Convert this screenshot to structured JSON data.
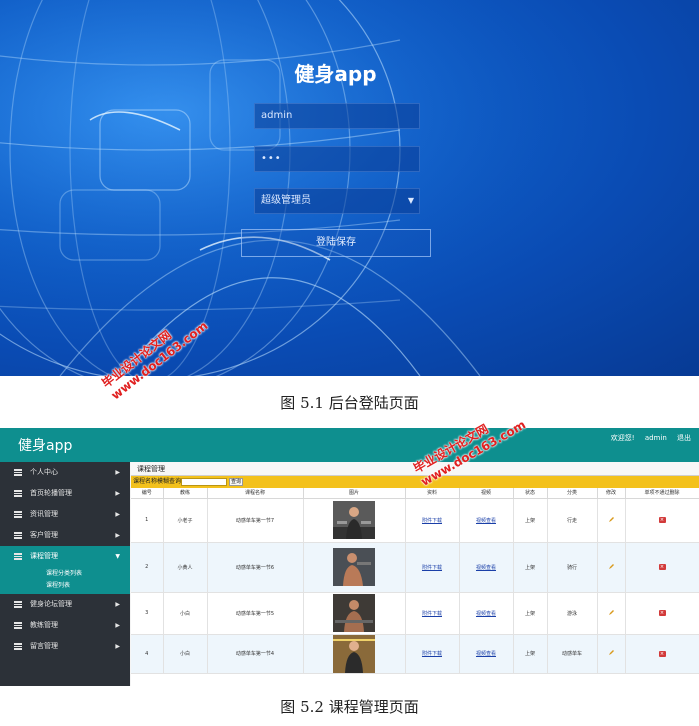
{
  "login": {
    "title": "健身app",
    "username": "admin",
    "password_mask": "•••",
    "role": "超级管理员",
    "submit": "登陆保存"
  },
  "captions": {
    "fig1": "图 5.1 后台登陆页面",
    "fig2": "图 5.2 课程管理页面"
  },
  "watermark": {
    "line1": "毕业设计论文网",
    "line2": "www.doc163.com"
  },
  "admin": {
    "app_title": "健身app",
    "top_links": [
      "欢迎您!",
      "admin",
      "退出"
    ],
    "sidebar": [
      {
        "label": "个人中心"
      },
      {
        "label": "首页轮播管理"
      },
      {
        "label": "资讯管理"
      },
      {
        "label": "客户管理"
      },
      {
        "label": "课程管理"
      },
      {
        "label": "健身论坛管理"
      },
      {
        "label": "教练管理"
      },
      {
        "label": "留言管理"
      }
    ],
    "sub_menu": [
      "课程分类列表",
      "课程列表"
    ],
    "content_title": "课程管理",
    "search_label": "课程名称模糊查询:",
    "search_button": "查询",
    "columns": [
      "编号",
      "教练",
      "课程名称",
      "图片",
      "资料",
      "视频",
      "状态",
      "分类",
      "修改",
      "单项不通过删除"
    ],
    "rows": [
      {
        "id": "1",
        "coach": "小老子",
        "name": "动感单车第一节7",
        "file": "附件下载",
        "video": "视频查看",
        "status": "上架",
        "category": "行走"
      },
      {
        "id": "2",
        "coach": "小黄人",
        "name": "动感单车第一节6",
        "file": "附件下载",
        "video": "视频查看",
        "status": "上架",
        "category": "骑行"
      },
      {
        "id": "3",
        "coach": "小白",
        "name": "动感单车第一节5",
        "file": "附件下载",
        "video": "视频查看",
        "status": "上架",
        "category": "游泳"
      },
      {
        "id": "4",
        "coach": "小白",
        "name": "动感单车第一节4",
        "file": "附件下载",
        "video": "视频查看",
        "status": "上架",
        "category": "动感单车"
      }
    ]
  }
}
